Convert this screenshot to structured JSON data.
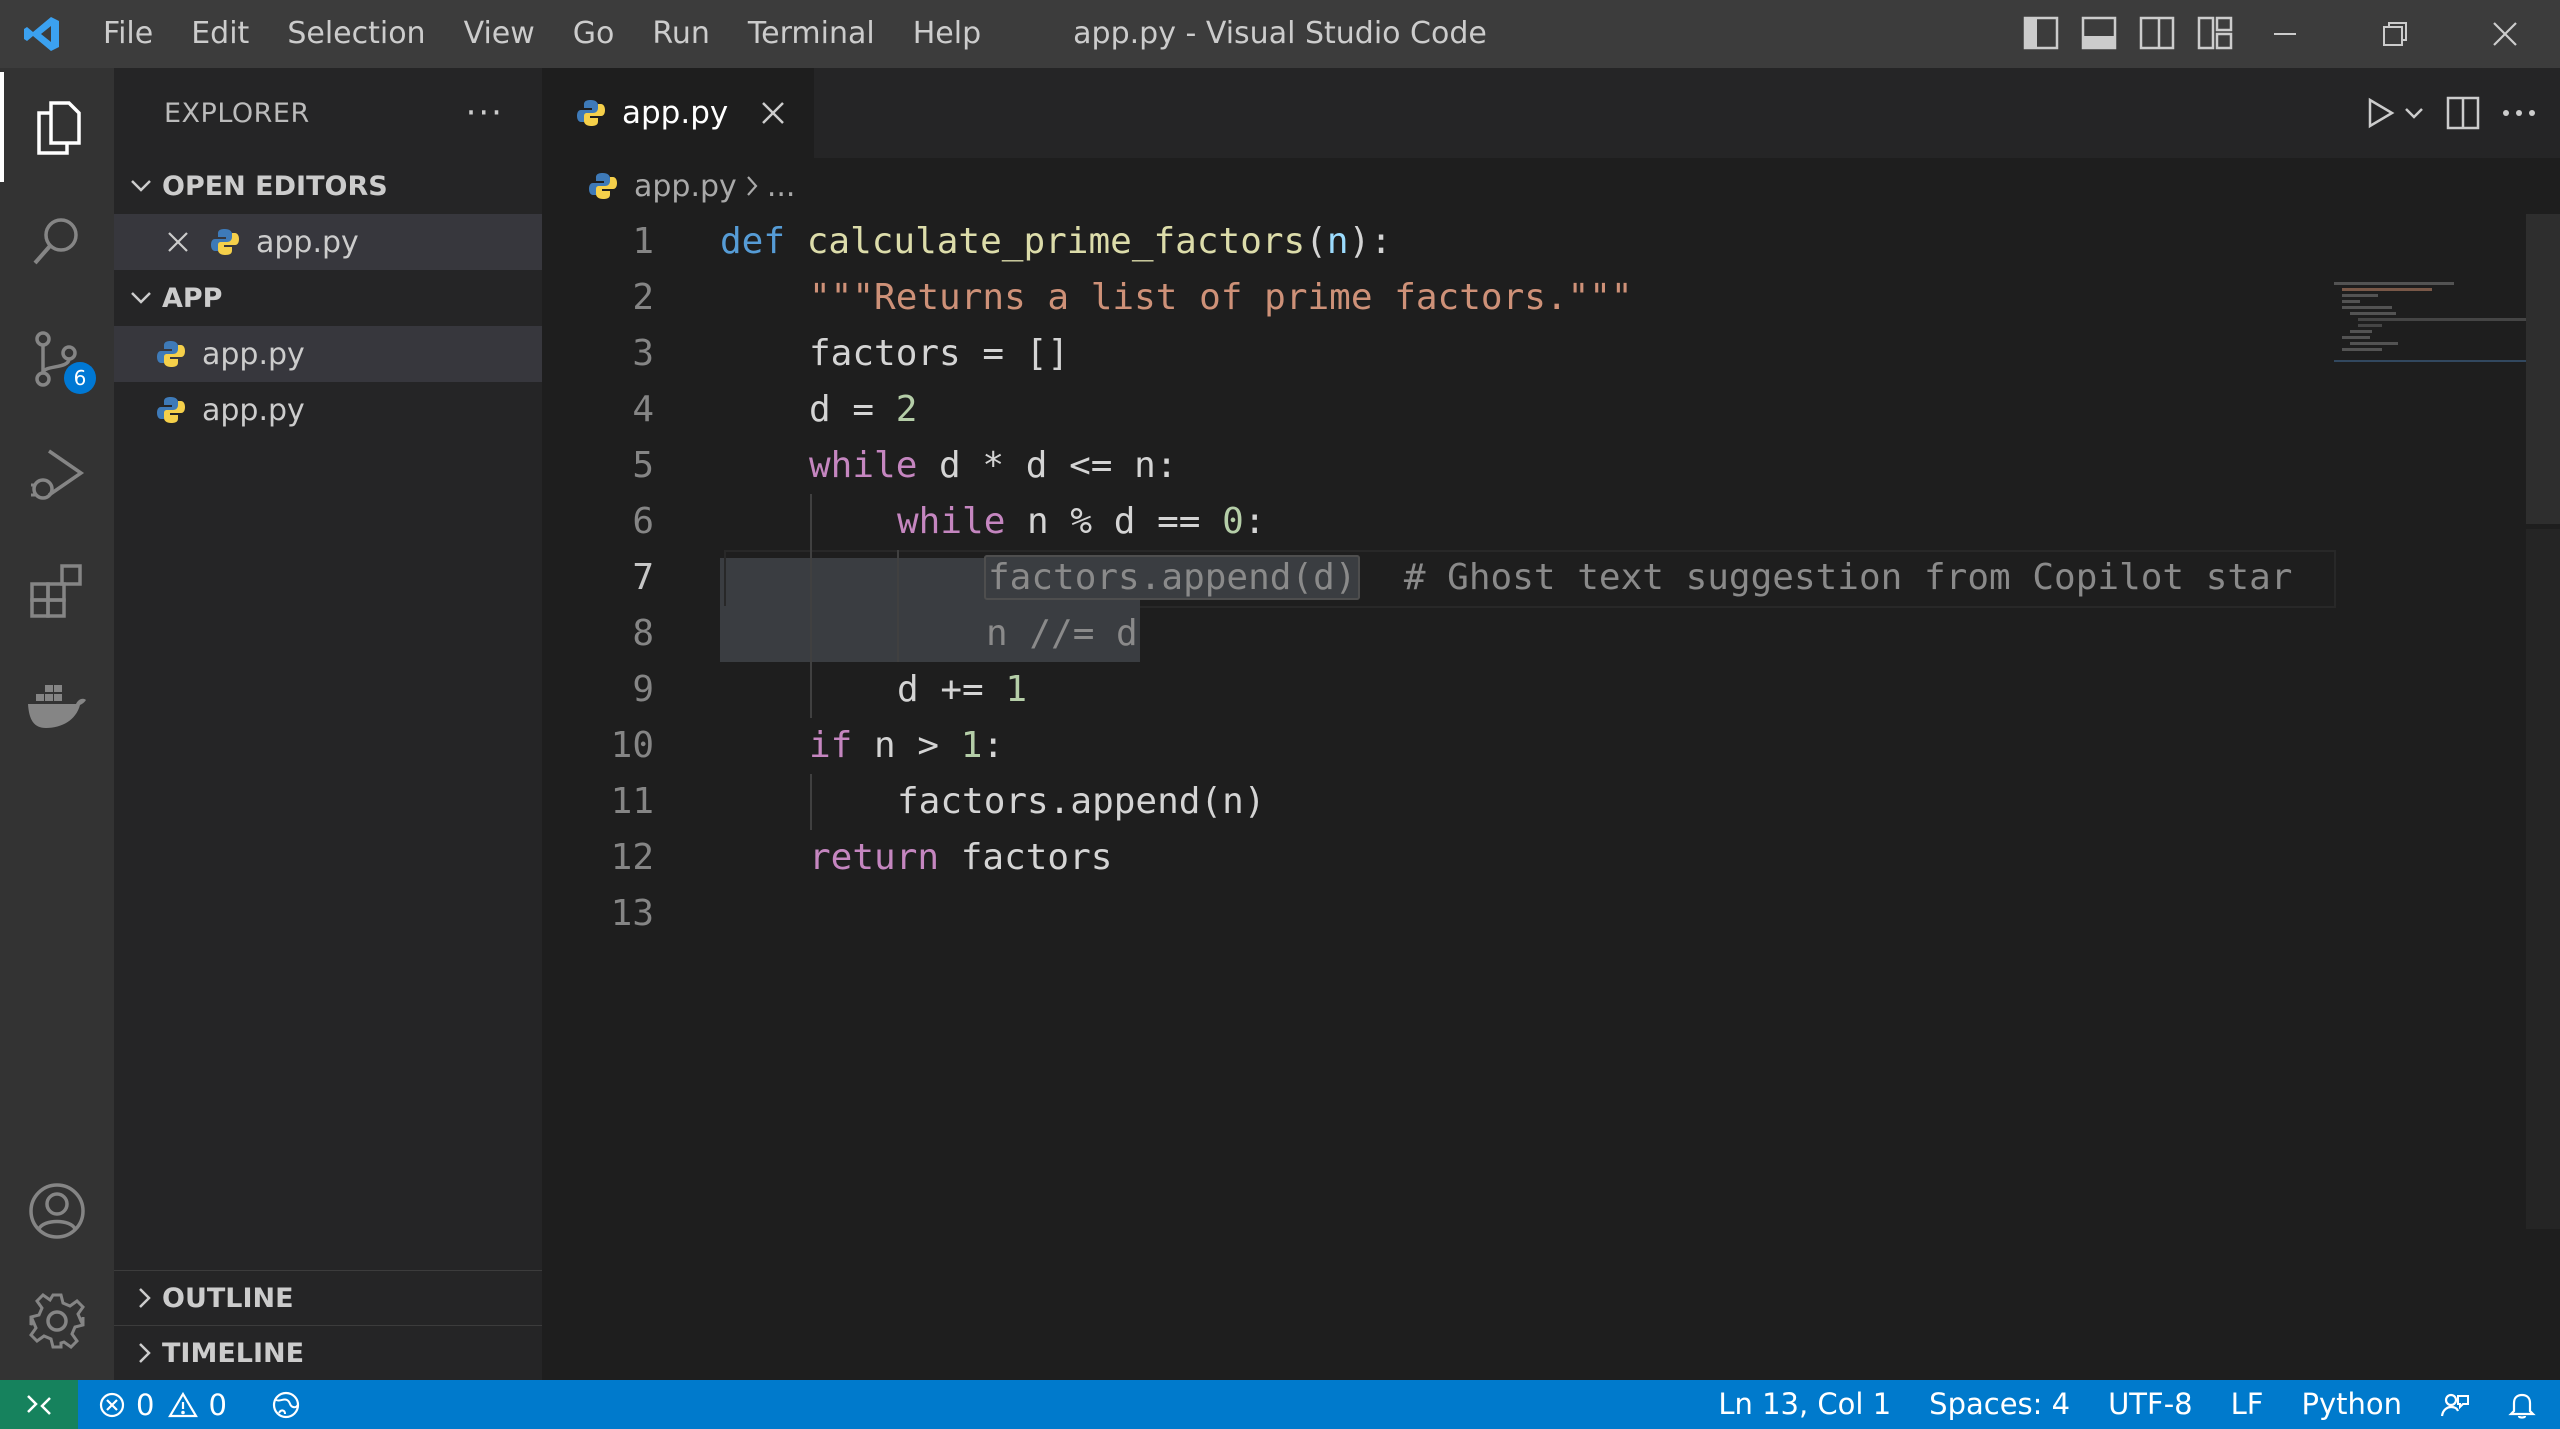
{
  "window": {
    "title": "app.py - Visual Studio Code",
    "menu": [
      "File",
      "Edit",
      "Selection",
      "View",
      "Go",
      "Run",
      "Terminal",
      "Help"
    ]
  },
  "activity_bar": {
    "items": [
      "explorer-icon",
      "search-icon",
      "source-control-icon",
      "run-debug-icon",
      "extensions-icon",
      "docker-icon"
    ],
    "source_control_badge": "6",
    "bottom": [
      "account-icon",
      "settings-gear-icon"
    ]
  },
  "sidebar": {
    "title": "EXPLORER",
    "more": "···",
    "open_editors": {
      "label": "OPEN EDITORS",
      "items": [
        {
          "name": "app.py"
        }
      ]
    },
    "folder": {
      "label": "APP",
      "items": [
        {
          "name": "app.py"
        },
        {
          "name": "app.py"
        }
      ]
    },
    "outline_label": "OUTLINE",
    "timeline_label": "TIMELINE"
  },
  "editor": {
    "tab": {
      "label": "app.py"
    },
    "breadcrumb": {
      "file": "app.py",
      "rest": "..."
    },
    "line_numbers": [
      "1",
      "2",
      "3",
      "4",
      "5",
      "6",
      "7",
      "8",
      "9",
      "10",
      "11",
      "12",
      "13"
    ],
    "current_line": "7",
    "code": {
      "l1": {
        "def": "def",
        "name": "calculate_prime_factors",
        "open": "(",
        "param": "n",
        "close": "):"
      },
      "l2": {
        "doc": "\"\"\"Returns a list of prime factors.\"\"\""
      },
      "l3": {
        "text": "factors = []"
      },
      "l4": {
        "pre": "d = ",
        "num": "2"
      },
      "l5": {
        "kw": "while",
        "text": " d * d <= n:"
      },
      "l6": {
        "kw": "while",
        "text": " n % d == ",
        "num": "0",
        "post": ":"
      },
      "l7": {
        "ghost": "factors.append(d)",
        "comment": "# Ghost text suggestion from Copilot star"
      },
      "l8": {
        "ghost": "n //= d"
      },
      "l9": {
        "pre": "d += ",
        "num": "1"
      },
      "l10": {
        "kw": "if",
        "text": " n > ",
        "num": "1",
        "post": ":"
      },
      "l11": {
        "text": "factors.append(n)"
      },
      "l12": {
        "kw": "return",
        "text": " factors"
      }
    }
  },
  "status_bar": {
    "errors": "0",
    "warnings": "0",
    "position": "Ln 13, Col 1",
    "spaces": "Spaces: 4",
    "encoding": "UTF-8",
    "eol": "LF",
    "language": "Python"
  }
}
